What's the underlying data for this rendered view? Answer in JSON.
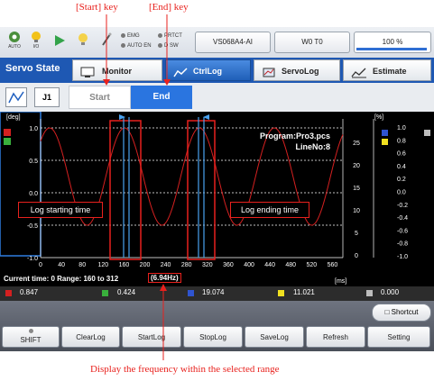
{
  "annotations": {
    "start_key": "[Start] key",
    "end_key": "[End] key",
    "log_start": "Log starting time",
    "log_end": "Log ending time",
    "frequency_note": "Display the frequency within the selected range"
  },
  "topbar": {
    "auto_label": "AUTO",
    "io_label": "I/O",
    "emg": "EMG",
    "auto_en": "AUTO EN",
    "prtct": "PRTCT",
    "d_sw": "D SW",
    "robot_name": "VS068A4-AI",
    "tool": "W0 T0",
    "speed": "100 %"
  },
  "tabs": {
    "title": "Servo State",
    "monitor": "Monitor",
    "ctrllog": "CtrlLog",
    "servolog": "ServoLog",
    "estimate": "Estimate"
  },
  "subbar": {
    "j_label": "J1",
    "start": "Start",
    "end": "End"
  },
  "plot": {
    "y_unit": "[deg]",
    "y2_unit": "[%]",
    "x_unit": "[ms]",
    "program": "Program:Pro3.pcs",
    "line_no": "LineNo:8",
    "y_ticks": [
      "1.0",
      "0.5",
      "0.0",
      "-0.5",
      "-1.0"
    ],
    "y2_ticks": [
      "25",
      "20",
      "15",
      "10",
      "5",
      "0"
    ],
    "y3_ticks": [
      "1.0",
      "0.8",
      "0.6",
      "0.4",
      "0.2",
      "0.0",
      "-0.2",
      "-0.4",
      "-0.6",
      "-0.8",
      "-1.0"
    ],
    "x_ticks": [
      "0",
      "40",
      "80",
      "120",
      "160",
      "200",
      "240",
      "280",
      "320",
      "360",
      "400",
      "440",
      "480",
      "520",
      "560"
    ],
    "current_time": "Current time: 0  Range: 160 to 312",
    "frequency": "(6.94Hz)"
  },
  "values": {
    "v1": "0.847",
    "v2": "0.424",
    "v3": "19.074",
    "v4": "11.021",
    "v5": "0.000",
    "colors": [
      "#d42020",
      "#39b03c",
      "#2f54d0",
      "#f0e020",
      "#bdbdbd"
    ]
  },
  "bottom": {
    "shortcut": "Shortcut",
    "shift": "SHIFT",
    "clearlog": "ClearLog",
    "startlog": "StartLog",
    "stoplog": "StopLog",
    "savelog": "SaveLog",
    "refresh": "Refresh",
    "setting": "Setting"
  }
}
